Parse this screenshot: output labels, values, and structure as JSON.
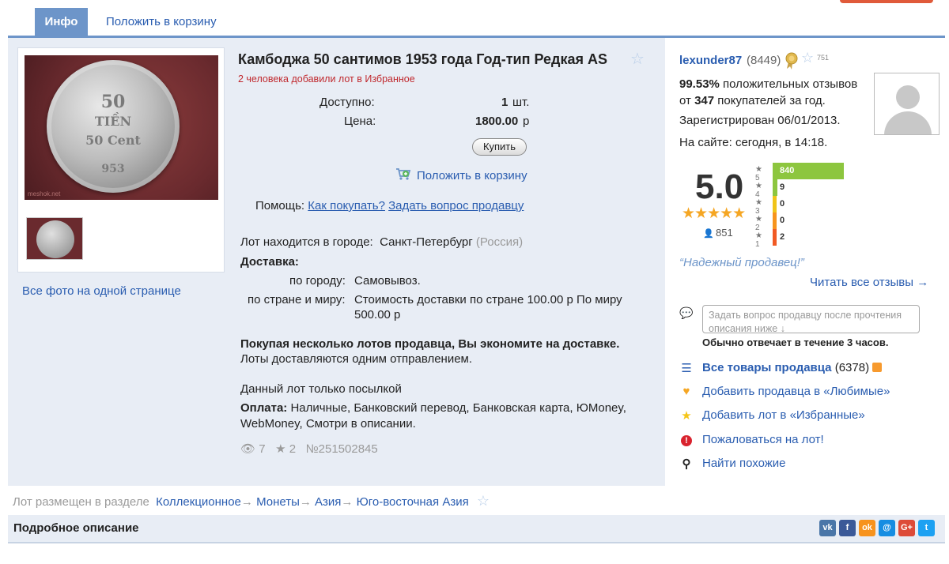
{
  "tabs": {
    "info": "Инфо",
    "cart": "Положить в корзину"
  },
  "lot": {
    "title": "Камбоджа 50 сантимов 1953 года Год-тип Редкая AS",
    "favorites_note": "2 человека добавили лот в Избранное",
    "available_label": "Доступно:",
    "available_value": "1",
    "available_unit": "шт.",
    "price_label": "Цена:",
    "price_value": "1800.00",
    "price_currency": "р",
    "buy_label": "Купить",
    "add_to_cart": "Положить в корзину",
    "help_label": "Помощь:",
    "help_how": "Как покупать?",
    "help_ask": "Задать вопрос продавцу",
    "city_label": "Лот находится в городе:",
    "city": "Санкт-Петербург",
    "country": "(Россия)",
    "delivery_title": "Доставка:",
    "delivery_city_label": "по городу:",
    "delivery_city_value": "Самовывоз.",
    "delivery_world_label": "по стране и миру:",
    "delivery_world_value_1": "Стоимость доставки по стране 100.00 р По миру",
    "delivery_world_value_2": "500.00 р",
    "save_note_bold": "Покупая несколько лотов продавца, Вы экономите на доставке.",
    "save_note": "Лоты доставляются одним отправлением.",
    "parcel_note": "Данный лот только посылкой",
    "payment_label": "Оплата:",
    "payment_value": "Наличные, Банковский перевод, Банковская карта, ЮMoney, WebMoney, Смотри в описании.",
    "views": "7",
    "stars": "2",
    "lot_number": "№251502845",
    "all_photos": "Все фото на одной странице",
    "coin_top_text": "50",
    "coin_mid_text": "TIỀN",
    "coin_bottom_text": "50 Cent",
    "coin_year_text": "953",
    "photo_watermark": "meshok.net"
  },
  "seller": {
    "name": "lexunder87",
    "feedback_count": "(8449)",
    "stars_count": "751",
    "positive_pct": "99.53%",
    "positive_text": "положительных отзывов",
    "from_label": "от",
    "buyers_count": "347",
    "buyers_text": "покупателей за год.",
    "registered": "Зарегистрирован 06/01/2013.",
    "online": "На сайте: сегодня, в 14:18.",
    "rating": "5.0",
    "reviews_total": "851",
    "reliable": "“Надежный продавец!”",
    "read_all": "Читать все отзывы →",
    "ask_placeholder": "Задать вопрос продавцу после прочтения описания ниже ↓",
    "reply_time": "Обычно отвечает в течение 3 часов.",
    "rating_bars": [
      {
        "star": "5",
        "value": "840",
        "fraction": 1.0,
        "color": "#8dc63f"
      },
      {
        "star": "4",
        "value": "9",
        "fraction": 0.012,
        "color": "#8dc63f"
      },
      {
        "star": "3",
        "value": "0",
        "fraction": 0,
        "color": "#f0c419"
      },
      {
        "star": "2",
        "value": "0",
        "fraction": 0,
        "color": "#f7941d"
      },
      {
        "star": "1",
        "value": "2",
        "fraction": 0.003,
        "color": "#f15a24"
      }
    ],
    "actions": {
      "all_items": "Все товары продавца",
      "all_items_count": "(6378)",
      "add_favorite_seller": "Добавить продавца в «Любимые»",
      "add_favorite_lot": "Добавить лот в «Избранные»",
      "report": "Пожаловаться на лот!",
      "find_similar": "Найти похожие"
    }
  },
  "breadcrumb": {
    "prefix": "Лот размещен в разделе",
    "items": [
      "Коллекционное",
      "Монеты",
      "Азия",
      "Юго-восточная Азия"
    ],
    "separator": "→"
  },
  "description": {
    "title": "Подробное описание"
  },
  "social": [
    {
      "icon": "vk-icon",
      "label": "vk",
      "color": "#4a76a8"
    },
    {
      "icon": "facebook-icon",
      "label": "f",
      "color": "#3b5998"
    },
    {
      "icon": "odnoklassniki-icon",
      "label": "ok",
      "color": "#f7931e"
    },
    {
      "icon": "mailru-icon",
      "label": "@",
      "color": "#168de2"
    },
    {
      "icon": "googleplus-icon",
      "label": "G+",
      "color": "#dd4b39"
    },
    {
      "icon": "twitter-icon",
      "label": "t",
      "color": "#1da1f2"
    }
  ]
}
